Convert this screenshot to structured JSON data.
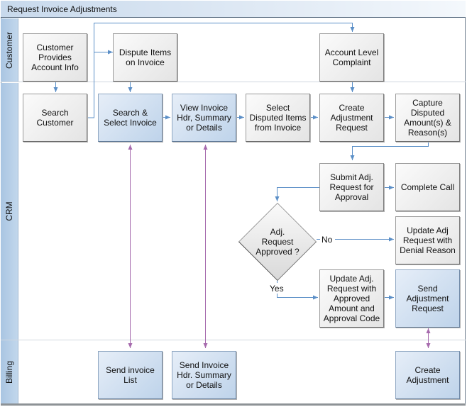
{
  "title": "Request Invoice Adjustments",
  "lanes": {
    "customer": "Customer",
    "crm": "CRM",
    "billing": "Billing"
  },
  "nodes": {
    "customer_provides_info": "Customer Provides Account Info",
    "dispute_items": "Dispute Items on Invoice",
    "account_level_complaint": "Account Level Complaint",
    "search_customer": "Search Customer",
    "search_select_invoice": "Search & Select Invoice",
    "view_invoice": "View Invoice Hdr, Summary or Details",
    "select_disputed_items": "Select Disputed Items from Invoice",
    "create_adjustment_request": "Create Adjustment Request",
    "capture_disputed_amounts": "Capture Disputed Amount(s) & Reason(s)",
    "submit_adj_request": "Submit Adj. Request for Approval",
    "complete_call": "Complete Call",
    "adj_request_approved": "Adj. Request Approved ?",
    "update_adj_denial": "Update Adj Request with Denial Reason",
    "update_adj_approved": "Update Adj. Request with Approved Amount and Approval Code",
    "send_adjustment_request": "Send Adjustment Request",
    "send_invoice_list": "Send invoice List",
    "send_invoice_hdr": "Send Invoice Hdr. Summary or Details",
    "create_adjustment": "Create Adjustment"
  },
  "edge_labels": {
    "no": "No",
    "yes": "Yes"
  },
  "colors": {
    "flow_arrow": "#5b8fc7",
    "system_arrow": "#a66aad",
    "lane_header": "#b4cde6",
    "system_node": "#c9dbee",
    "manual_node": "#ececec"
  }
}
